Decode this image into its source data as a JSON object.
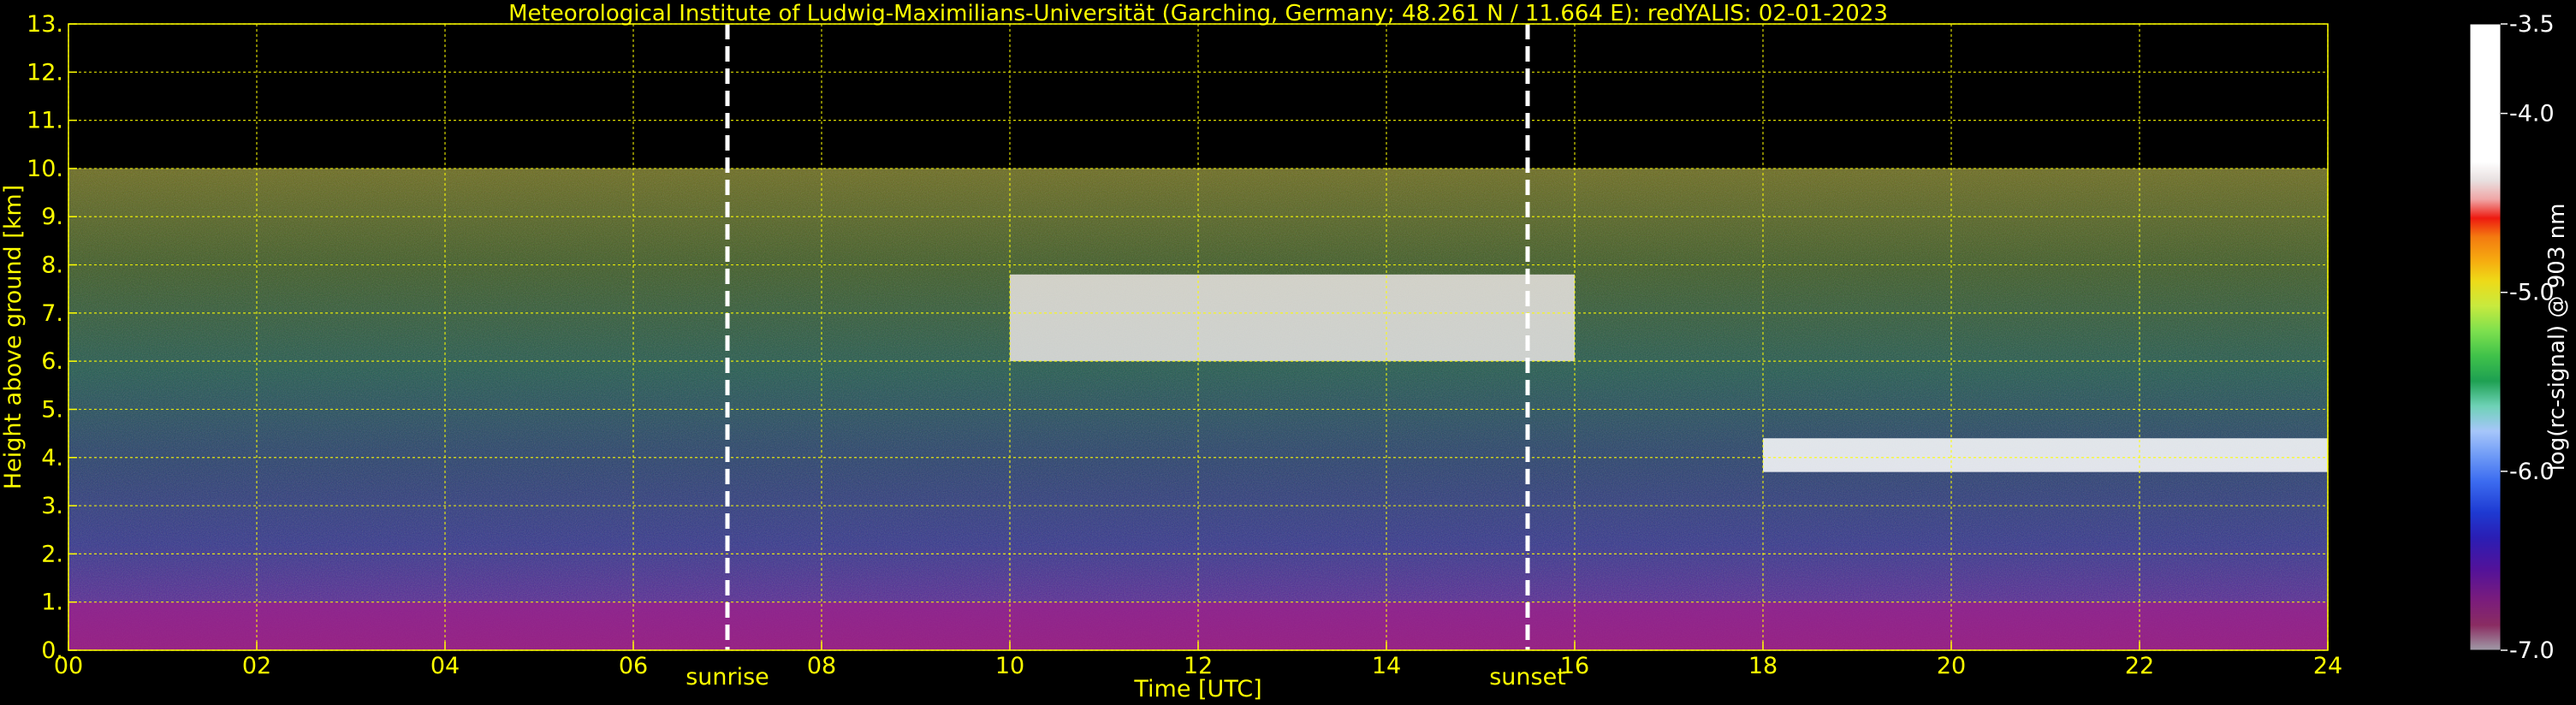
{
  "chart_data": {
    "type": "heatmap",
    "title": "Meteorological Institute of Ludwig-Maximilians-Universität (Garching, Germany; 48.261 N / 11.664 E):    redYALIS: 02-01-2023",
    "xlabel": "Time [UTC]",
    "ylabel": "Height above ground [km]",
    "xlim": [
      0,
      24
    ],
    "ylim": [
      0,
      13
    ],
    "x_ticks": [
      "00",
      "02",
      "04",
      "06",
      "08",
      "10",
      "12",
      "14",
      "16",
      "18",
      "20",
      "22",
      "24"
    ],
    "y_ticks": [
      "0.",
      "1.",
      "2.",
      "3.",
      "4.",
      "5.",
      "6.",
      "7.",
      "8.",
      "9.",
      "10.",
      "11.",
      "12.",
      "13."
    ],
    "grid": true,
    "data_top_km": 10,
    "markers": [
      {
        "label": "sunrise",
        "x": 7.0
      },
      {
        "label": "sunset",
        "x": 15.5
      }
    ],
    "colorbar": {
      "label": "log(rc-signal) @ 903 nm",
      "range": [
        -7.0,
        -3.5
      ],
      "ticks": [
        "-3.5",
        "-4.0",
        "-5.0",
        "-6.0",
        "-7.0"
      ],
      "tick_values": [
        -3.5,
        -4.0,
        -5.0,
        -6.0,
        -7.0
      ],
      "colors": [
        "#a09ca8",
        "#8a2c62",
        "#7a1c7c",
        "#52129a",
        "#2a1eb4",
        "#1e3ad2",
        "#3c6cf0",
        "#6e9af6",
        "#a6c6fa",
        "#6ed2b6",
        "#1ea052",
        "#40c24a",
        "#7ee04e",
        "#c8ea3e",
        "#eeda18",
        "#f6ae10",
        "#f47a10",
        "#ee1a10",
        "#f0a6a6",
        "#e8e0e0",
        "#ffffff"
      ]
    },
    "features": [
      {
        "name": "cirrus band",
        "x": [
          10.0,
          16.0
        ],
        "y": [
          6.0,
          7.8
        ]
      },
      {
        "name": "mid-level cloud",
        "x": [
          18.0,
          24.0
        ],
        "y": [
          3.7,
          4.4
        ]
      },
      {
        "name": "boundary layer",
        "x": [
          0,
          24
        ],
        "y": [
          0,
          1.0
        ]
      }
    ]
  }
}
